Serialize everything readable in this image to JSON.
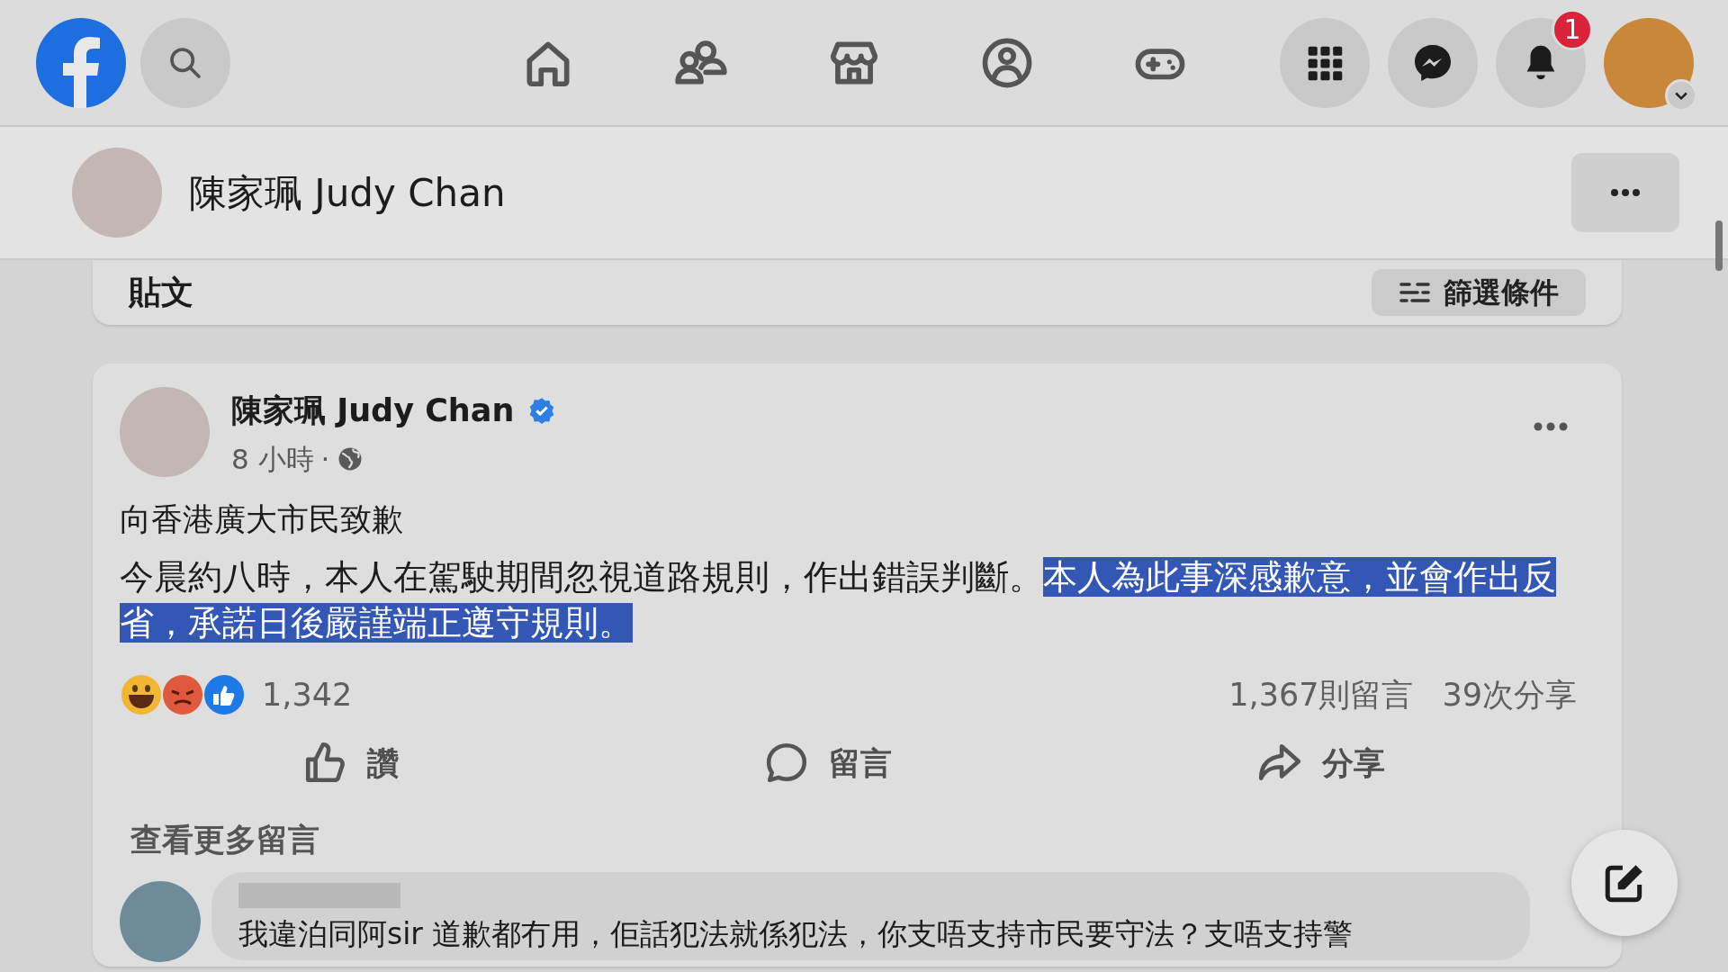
{
  "top_bar": {
    "notification_count": "1"
  },
  "page_header": {
    "name": "陳家珮 Judy Chan"
  },
  "filter_card": {
    "title": "貼文",
    "filter_button": "篩選條件"
  },
  "post": {
    "author": "陳家珮 Judy Chan",
    "verified": true,
    "time": "8 小時",
    "separator": "·",
    "title": "向香港廣大市民致歉",
    "body": [
      {
        "text": "今晨約八時，本人在駕駛期間忽視道路規則，作出錯誤判斷。",
        "selected": false
      },
      {
        "text": "本人為此事深感歉意，並會作出反省，承諾日後嚴謹端正遵守規則。",
        "selected": true
      }
    ],
    "reaction_count": "1,342",
    "comment_count": "1,367則留言",
    "share_count": "39次分享",
    "actions": [
      {
        "kind": "like",
        "label": "讚"
      },
      {
        "kind": "comment",
        "label": "留言"
      },
      {
        "kind": "share",
        "label": "分享"
      }
    ],
    "more_comments": "查看更多留言",
    "comment": {
      "text": "我違泊同阿sir 道歉都冇用，佢話犯法就係犯法，你支唔支持市民要守法？支唔支持警"
    }
  }
}
